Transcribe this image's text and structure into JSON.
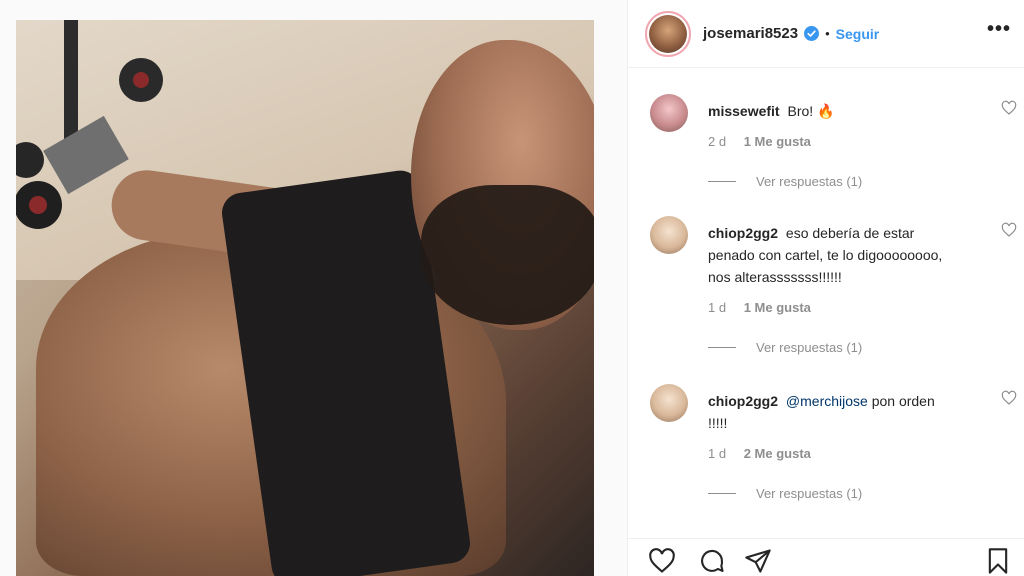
{
  "post": {
    "username": "josemari8523",
    "separator": "•",
    "follow_label": "Seguir",
    "more_label": "•••"
  },
  "comments": [
    {
      "user": "missewefit",
      "text": "Bro! 🔥",
      "time": "2 d",
      "likes": "1 Me gusta",
      "replies": "Ver respuestas (1)"
    },
    {
      "user": "chiop2gg2",
      "text": "eso debería de estar penado con cartel, te lo digoooooooo, nos alterasssssss!!!!!!",
      "time": "1 d",
      "likes": "1 Me gusta",
      "replies": "Ver respuestas (1)"
    },
    {
      "user": "chiop2gg2",
      "mention": "@merchijose",
      "text": "pon orden !!!!!",
      "time": "1 d",
      "likes": "2 Me gusta",
      "replies": "Ver respuestas (1)"
    }
  ],
  "icons": {
    "verified": "verified-badge-icon",
    "heart": "heart-icon",
    "comment": "comment-icon",
    "share": "share-icon",
    "save": "bookmark-icon"
  },
  "colors": {
    "link": "#3897f0",
    "verified": "#3897f0",
    "mention": "#003569",
    "muted": "#8e8e8e"
  }
}
